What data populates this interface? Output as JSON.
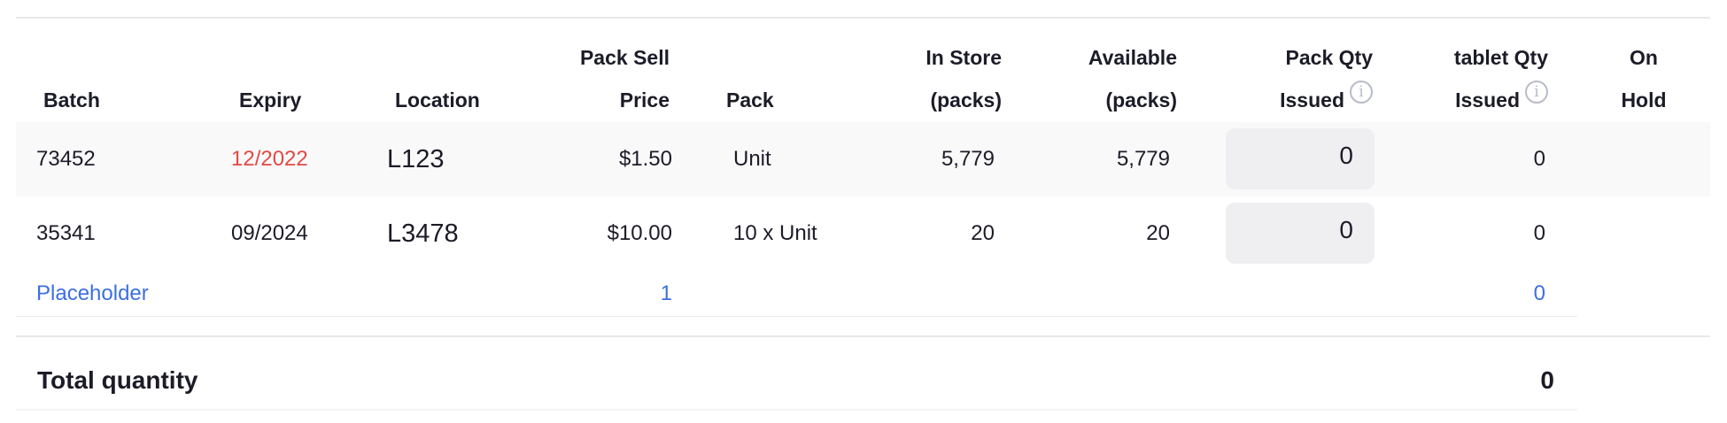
{
  "headers": {
    "batch": "Batch",
    "expiry": "Expiry",
    "location": "Location",
    "pack_sell_price": [
      "Pack Sell",
      "Price"
    ],
    "pack": "Pack",
    "in_store": [
      "In Store",
      "(packs)"
    ],
    "available": [
      "Available",
      "(packs)"
    ],
    "pack_qty_issued": [
      "Pack Qty",
      "Issued"
    ],
    "tablet_qty_issued": [
      "tablet Qty",
      "Issued"
    ],
    "on_hold": [
      "On",
      "Hold"
    ],
    "info_icon_glyph": "i"
  },
  "rows": [
    {
      "batch": "73452",
      "expiry": "12/2022",
      "expired": true,
      "location": "L123",
      "pack_sell_price": "$1.50",
      "pack": "Unit",
      "in_store": "5,779",
      "available": "5,779",
      "pack_qty_issued": "0",
      "tablet_qty_issued": "0"
    },
    {
      "batch": "35341",
      "expiry": "09/2024",
      "expired": false,
      "location": "L3478",
      "pack_sell_price": "$10.00",
      "pack": "10 x Unit",
      "in_store": "20",
      "available": "20",
      "pack_qty_issued": "0",
      "tablet_qty_issued": "0"
    }
  ],
  "placeholder": {
    "label": "Placeholder",
    "pack_qty": "1",
    "tablet_qty": "0"
  },
  "total": {
    "label": "Total quantity",
    "value": "0"
  },
  "colors": {
    "expired_text": "#e04a44",
    "placeholder_text": "#3c6fe3",
    "qty_input_bg": "#efeff2"
  }
}
